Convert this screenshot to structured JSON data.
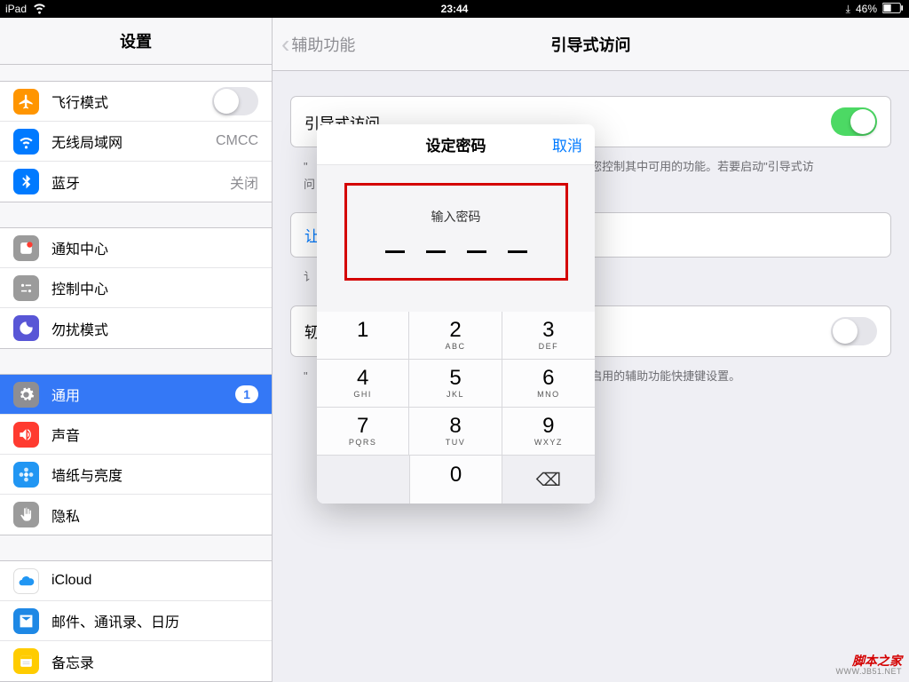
{
  "status": {
    "device": "iPad",
    "time": "23:44",
    "battery": "46%"
  },
  "sidebar": {
    "title": "设置",
    "groups": [
      [
        {
          "name": "airplane",
          "label": "飞行模式",
          "color": "#ff9500",
          "icon": "plane",
          "toggle": false
        },
        {
          "name": "wifi",
          "label": "无线局域网",
          "color": "#007aff",
          "icon": "wifi",
          "detail": "CMCC"
        },
        {
          "name": "bluetooth",
          "label": "蓝牙",
          "color": "#007aff",
          "icon": "bt",
          "detail": "关闭"
        }
      ],
      [
        {
          "name": "notifications",
          "label": "通知中心",
          "color": "#9b9b9b",
          "icon": "notif"
        },
        {
          "name": "control",
          "label": "控制中心",
          "color": "#9b9b9b",
          "icon": "ctrl"
        },
        {
          "name": "dnd",
          "label": "勿扰模式",
          "color": "#5856d6",
          "icon": "moon"
        }
      ],
      [
        {
          "name": "general",
          "label": "通用",
          "color": "#8e8e93",
          "icon": "gear",
          "selected": true,
          "badge": "1"
        },
        {
          "name": "sounds",
          "label": "声音",
          "color": "#ff3b30",
          "icon": "speaker"
        },
        {
          "name": "wallpaper",
          "label": "墙纸与亮度",
          "color": "#2196f3",
          "icon": "flower"
        },
        {
          "name": "privacy",
          "label": "隐私",
          "color": "#9b9b9b",
          "icon": "hand"
        }
      ],
      [
        {
          "name": "icloud",
          "label": "iCloud",
          "color": "#fff",
          "icon": "cloud",
          "iconColor": "#2196f3"
        },
        {
          "name": "mail",
          "label": "邮件、通讯录、日历",
          "color": "#1e88e5",
          "icon": "mail"
        },
        {
          "name": "notes",
          "label": "备忘录",
          "color": "#ffcc00",
          "icon": "notes"
        }
      ]
    ]
  },
  "main": {
    "back": "辅助功能",
    "title": "引导式访问",
    "guided": {
      "label": "引导式访问",
      "on": true
    },
    "note1a": "您控制其中可用的功能。若要启动\"引导式访",
    "note1b": "\"",
    "row2": "让",
    "note2": "讠",
    "row3": "轫",
    "note3": "已启用的辅助功能快捷键设置。"
  },
  "modal": {
    "title": "设定密码",
    "cancel": "取消",
    "prompt": "输入密码",
    "keys": [
      {
        "n": "1",
        "l": ""
      },
      {
        "n": "2",
        "l": "ABC"
      },
      {
        "n": "3",
        "l": "DEF"
      },
      {
        "n": "4",
        "l": "GHI"
      },
      {
        "n": "5",
        "l": "JKL"
      },
      {
        "n": "6",
        "l": "MNO"
      },
      {
        "n": "7",
        "l": "PQRS"
      },
      {
        "n": "8",
        "l": "TUV"
      },
      {
        "n": "9",
        "l": "WXYZ"
      },
      {
        "blank": true
      },
      {
        "n": "0",
        "l": ""
      },
      {
        "del": true
      }
    ]
  },
  "watermark": {
    "main": "脚本之家",
    "sub": "WWW.JB51.NET"
  }
}
